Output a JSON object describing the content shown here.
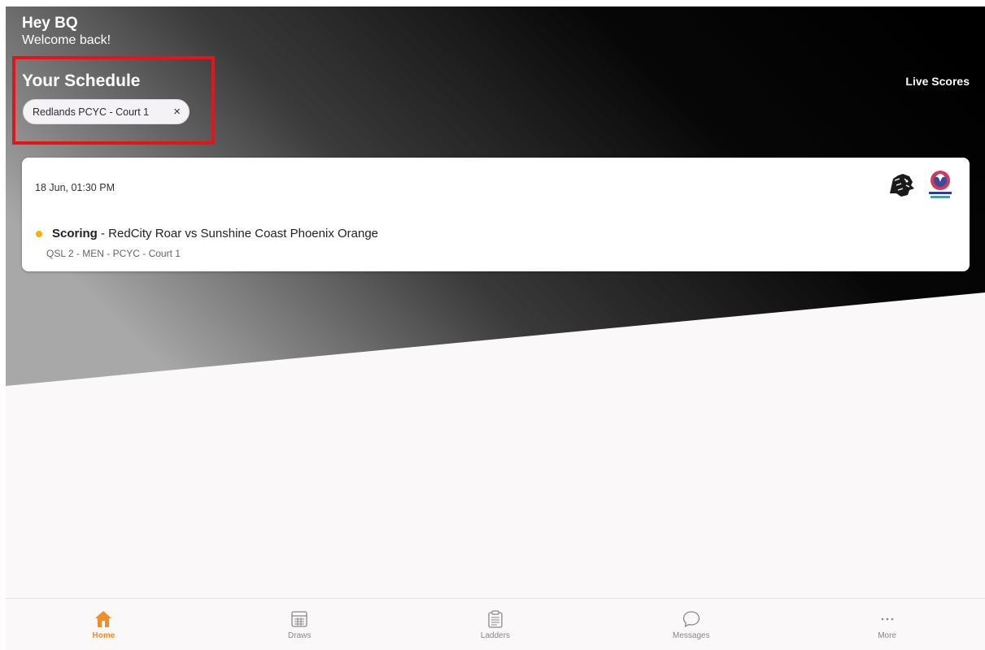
{
  "header": {
    "greeting": "Hey BQ",
    "subtitle": "Welcome back!",
    "schedule_title": "Your Schedule",
    "live_scores": "Live Scores"
  },
  "filter_chip": {
    "label": "Redlands PCYC - Court 1",
    "close_glyph": "×"
  },
  "match": {
    "datetime": "18 Jun, 01:30 PM",
    "status": "Scoring",
    "teams": " - RedCity Roar vs Sunshine Coast Phoenix Orange",
    "details": "QSL 2 - MEN - PCYC - Court 1",
    "status_color": "#f5b400",
    "home_logo_icon": "lion-logo",
    "away_logo_icon": "phoenix-logo"
  },
  "bottom_nav": [
    {
      "label": "Home",
      "icon": "home-icon",
      "active": true
    },
    {
      "label": "Draws",
      "icon": "calendar-grid-icon",
      "active": false
    },
    {
      "label": "Ladders",
      "icon": "clipboard-list-icon",
      "active": false
    },
    {
      "label": "Messages",
      "icon": "chat-bubble-icon",
      "active": false
    },
    {
      "label": "More",
      "icon": "more-dots-icon",
      "active": false
    }
  ],
  "colors": {
    "accent": "#f28c28",
    "highlight_box": "#e5141b",
    "hero_dark": "#000000",
    "hero_light": "#a8a8a8"
  }
}
